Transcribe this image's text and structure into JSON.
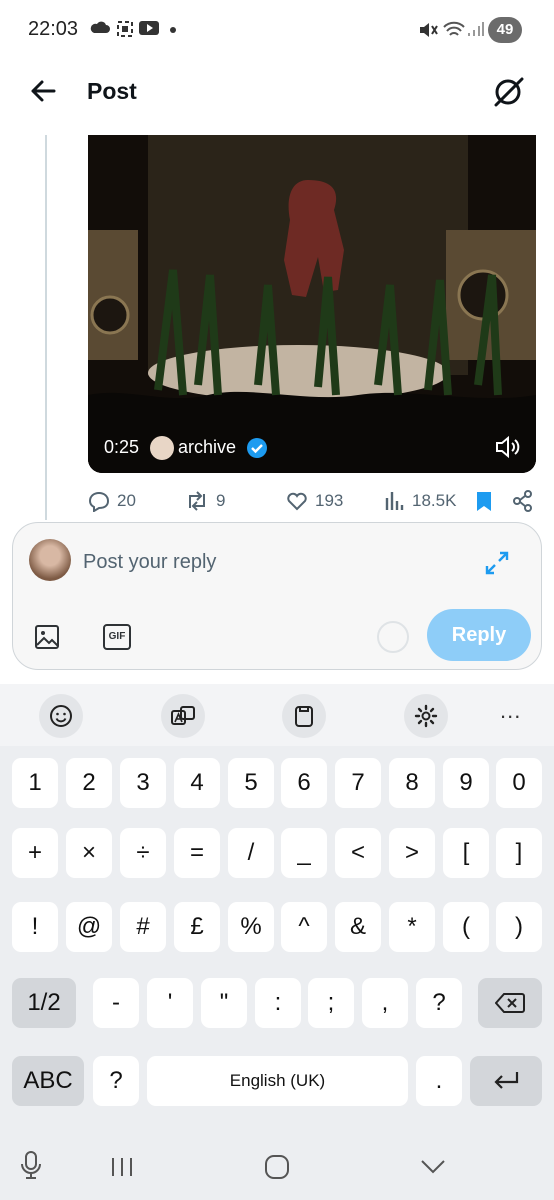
{
  "status_bar": {
    "time": "22:03",
    "battery": "49"
  },
  "header": {
    "title": "Post"
  },
  "video": {
    "elapsed": "0:25",
    "username": "archive"
  },
  "actions": {
    "replies": "20",
    "reposts": "9",
    "likes": "193",
    "views": "18.5K"
  },
  "reply_box": {
    "placeholder": "Post your reply",
    "reply_label": "Reply",
    "gif_label": "GIF"
  },
  "keyboard": {
    "row1": [
      "1",
      "2",
      "3",
      "4",
      "5",
      "6",
      "7",
      "8",
      "9",
      "0"
    ],
    "row2": [
      "+",
      "×",
      "÷",
      "=",
      "/",
      "_",
      "<",
      ">",
      "[",
      "]"
    ],
    "row3": [
      "!",
      "@",
      "#",
      "£",
      "%",
      "^",
      "&",
      "*",
      "(",
      ")"
    ],
    "row4": [
      "1/2",
      "-",
      "'",
      "\"",
      ":",
      ";",
      ",",
      "?"
    ],
    "row5": {
      "abc": "ABC",
      "question": "?",
      "space": "English (UK)",
      "period": "."
    },
    "more": "..."
  },
  "colors": {
    "accent": "#1d9bf0",
    "reply_button": "#8ecdf8"
  }
}
